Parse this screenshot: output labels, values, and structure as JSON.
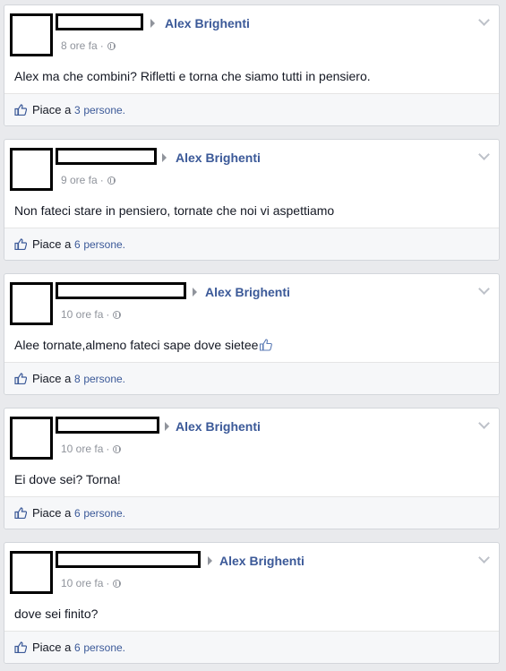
{
  "posts": [
    {
      "target": "Alex Brighenti",
      "time": "8 ore fa",
      "text": "Alex ma che combini? Rifletti e torna che siamo tutti in pensiero.",
      "like_prefix": "Piace a",
      "like_count": "3",
      "like_suffix": "persone."
    },
    {
      "target": "Alex Brighenti",
      "time": "9 ore fa",
      "text": "Non fateci stare in pensiero, tornate che noi vi aspettiamo",
      "like_prefix": "Piace a",
      "like_count": "6",
      "like_suffix": "persone."
    },
    {
      "target": "Alex Brighenti",
      "time": "10 ore fa",
      "text": "Alee tornate,almeno fateci sape dove sietee",
      "like_prefix": "Piace a",
      "like_count": "8",
      "like_suffix": "persone."
    },
    {
      "target": "Alex Brighenti",
      "time": "10 ore fa",
      "text": "Ei dove sei? Torna!",
      "like_prefix": "Piace a",
      "like_count": "6",
      "like_suffix": "persone."
    },
    {
      "target": "Alex Brighenti",
      "time": "10 ore fa",
      "text": "dove sei finito?",
      "like_prefix": "Piace a",
      "like_count": "6",
      "like_suffix": "persone."
    }
  ],
  "icons": {
    "arrow": "right-triangle-icon",
    "privacy": "globe-icon",
    "options": "chevron-down-icon",
    "like": "thumbs-up-icon",
    "emoticon": "thumbs-up-emoticon-icon"
  },
  "colors": {
    "link": "#3b5998",
    "muted": "#90949c",
    "background": "#e9eaed"
  }
}
